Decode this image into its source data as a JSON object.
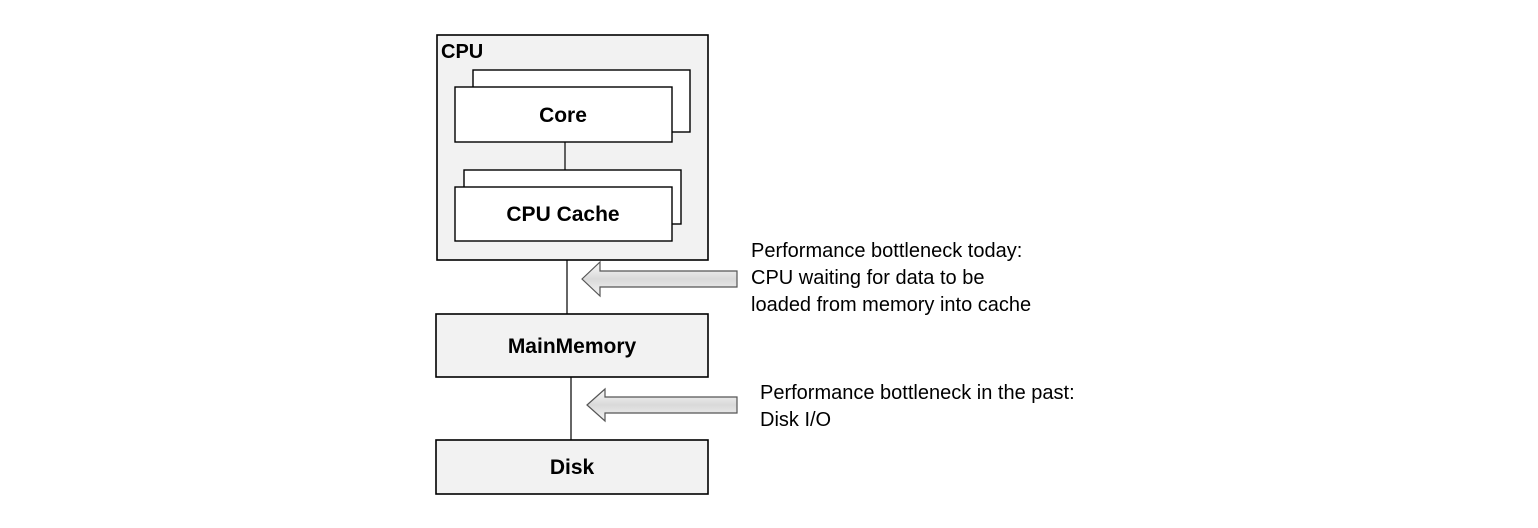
{
  "cpu": {
    "label": "CPU"
  },
  "core": {
    "label": "Core"
  },
  "cache": {
    "label": "CPU Cache"
  },
  "memory": {
    "label": "MainMemory"
  },
  "disk": {
    "label": "Disk"
  },
  "note_today": {
    "lines": [
      "Performance bottleneck today:",
      "CPU waiting for data to be",
      "loaded from memory into cache"
    ]
  },
  "note_past": {
    "lines": [
      "Performance bottleneck in the past:",
      "Disk I/O"
    ]
  },
  "colors": {
    "box_fill": "#f2f2f2",
    "inner_fill": "#ffffff",
    "stroke": "#000000",
    "arrow_fill": "#e6e6e6",
    "arrow_stroke": "#555555"
  }
}
